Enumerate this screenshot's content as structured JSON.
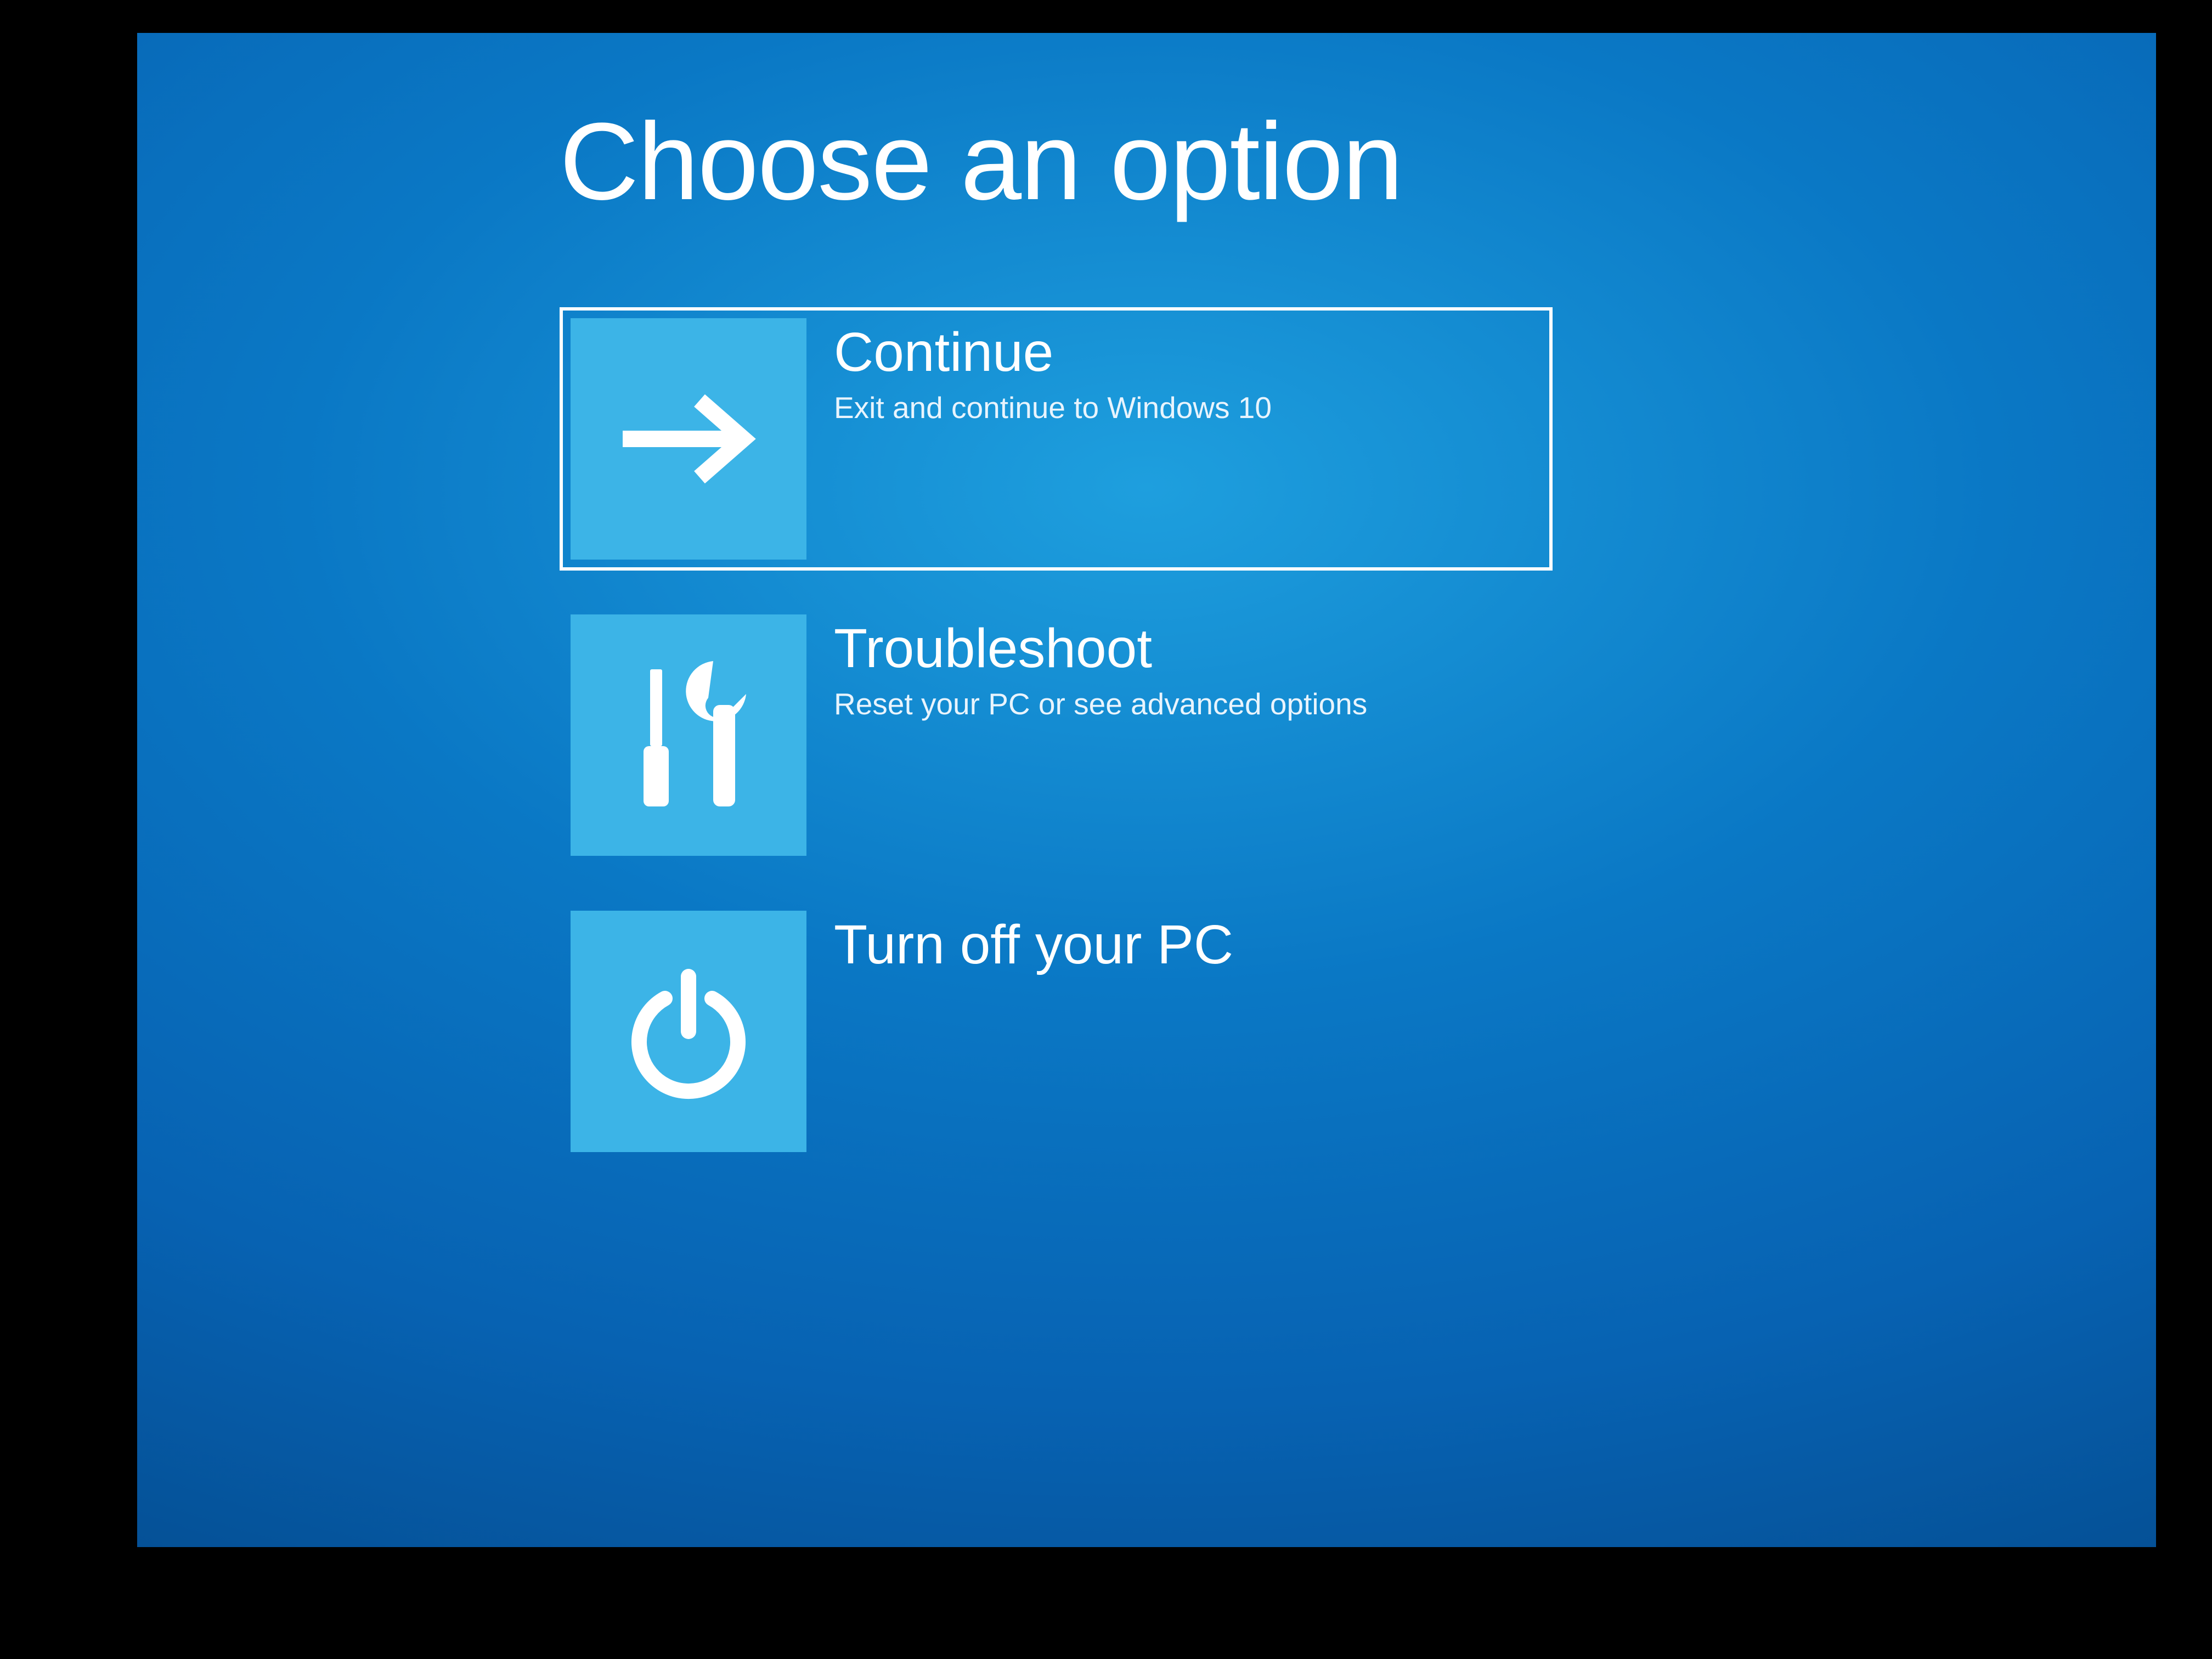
{
  "heading": "Choose an option",
  "options": {
    "continue": {
      "title": "Continue",
      "desc": "Exit and continue to Windows 10",
      "icon": "arrow-right"
    },
    "troubleshoot": {
      "title": "Troubleshoot",
      "desc": "Reset your PC or see advanced options",
      "icon": "tools"
    },
    "poweroff": {
      "title": "Turn off your PC",
      "desc": "",
      "icon": "power"
    }
  },
  "colors": {
    "tile": "#3cb4e7",
    "bg_gradient_center": "#1e9fde",
    "bg_gradient_edge": "#033869",
    "selection_border": "#ffffff"
  }
}
